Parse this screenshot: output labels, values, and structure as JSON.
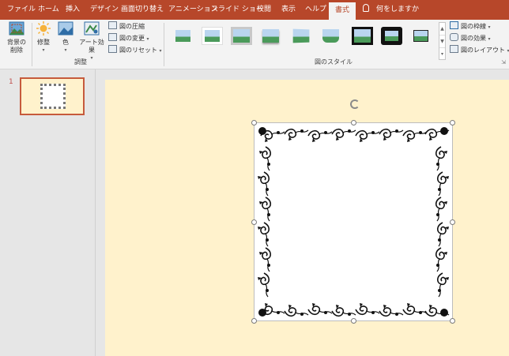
{
  "tabs": [
    {
      "label": "ファイル",
      "active": false
    },
    {
      "label": "ホーム",
      "active": false
    },
    {
      "label": "挿入",
      "active": false
    },
    {
      "label": "デザイン",
      "active": false
    },
    {
      "label": "画面切り替え",
      "active": false
    },
    {
      "label": "アニメーション",
      "active": false
    },
    {
      "label": "スライド ショー",
      "active": false
    },
    {
      "label": "校閲",
      "active": false
    },
    {
      "label": "表示",
      "active": false
    },
    {
      "label": "ヘルプ",
      "active": false
    },
    {
      "label": "書式",
      "active": true
    }
  ],
  "tellme": "何をしますか",
  "ribbon": {
    "remove_bg": {
      "line1": "背景の",
      "line2": "削除"
    },
    "corrections": "修整",
    "color": "色",
    "artistic": {
      "line1": "アート効果"
    },
    "compress": "図の圧縮",
    "change": "図の変更",
    "reset": "図のリセット",
    "adjust_group": "調整",
    "styles_group": "図のスタイル",
    "border": "図の枠線",
    "effects": "図の効果",
    "layout": "図のレイアウト"
  },
  "slides": {
    "number": "1"
  },
  "colors": {
    "accent": "#b7472a",
    "slide_bg": "#fff2cc"
  }
}
